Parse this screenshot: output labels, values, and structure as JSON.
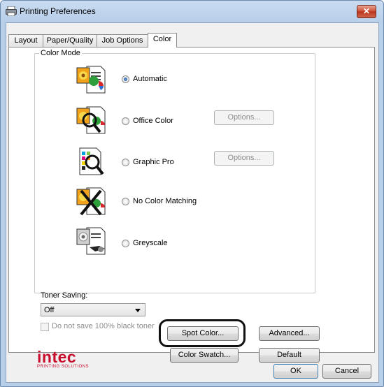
{
  "window": {
    "title": "Printing Preferences",
    "close_glyph": "✕"
  },
  "tabs": [
    {
      "label": "Layout",
      "active": false
    },
    {
      "label": "Paper/Quality",
      "active": false
    },
    {
      "label": "Job Options",
      "active": false
    },
    {
      "label": "Color",
      "active": true
    }
  ],
  "color_mode": {
    "group_label": "Color Mode",
    "options": [
      {
        "label": "Automatic",
        "checked": true,
        "icon": "automatic-color-icon"
      },
      {
        "label": "Office Color",
        "checked": false,
        "icon": "office-color-icon",
        "options_button": "Options..."
      },
      {
        "label": "Graphic Pro",
        "checked": false,
        "icon": "graphic-pro-icon",
        "options_button": "Options..."
      },
      {
        "label": "No Color Matching",
        "checked": false,
        "icon": "no-color-matching-icon"
      },
      {
        "label": "Greyscale",
        "checked": false,
        "icon": "greyscale-icon"
      }
    ]
  },
  "toner_saving": {
    "label": "Toner Saving:",
    "value": "Off",
    "checkbox_label": "Do not save 100% black toner",
    "checkbox_checked": false,
    "checkbox_enabled": false
  },
  "buttons": {
    "spot_color": "Spot Color...",
    "color_swatch": "Color Swatch...",
    "advanced": "Advanced...",
    "default": "Default",
    "ok": "OK",
    "cancel": "Cancel"
  },
  "logo": {
    "name": "intec",
    "tagline": "PRINTING SOLUTIONS",
    "color": "#c8102e"
  },
  "colors": {
    "highlight_ring": "#111111",
    "title_bar": "#b8cfea",
    "close_button": "#cc4b32"
  }
}
